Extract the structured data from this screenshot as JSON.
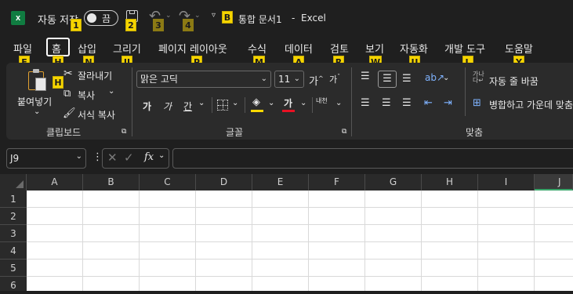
{
  "titlebar": {
    "autosave_label": "자동 저장",
    "autosave_state": "끔",
    "title": "통합 문서1",
    "separator": "-",
    "app_name": "Excel",
    "keytips": {
      "autosave": "1",
      "save": "2",
      "undo": "3",
      "redo": "4",
      "title": "B"
    }
  },
  "tabs": [
    {
      "label": "파일",
      "keytip": "F"
    },
    {
      "label": "홈",
      "keytip": "H"
    },
    {
      "label": "삽입",
      "keytip": "N"
    },
    {
      "label": "그리기",
      "keytip": "JI"
    },
    {
      "label": "페이지 레이아웃",
      "keytip": "P"
    },
    {
      "label": "수식",
      "keytip": "M"
    },
    {
      "label": "데이터",
      "keytip": "A"
    },
    {
      "label": "검토",
      "keytip": "R"
    },
    {
      "label": "보기",
      "keytip": "W"
    },
    {
      "label": "자동화",
      "keytip": "U"
    },
    {
      "label": "개발 도구",
      "keytip": "L"
    },
    {
      "label": "도움말",
      "keytip": "Y"
    }
  ],
  "clipboard": {
    "paste_label": "붙여넣기",
    "cut_label": "잘라내기",
    "copy_label": "복사",
    "format_painter_label": "서식 복사",
    "group_label": "클립보드"
  },
  "font": {
    "name": "맑은 고딕",
    "size": "11",
    "bold": "가",
    "italic": "가",
    "underline": "간",
    "font_color_glyph": "가",
    "phonetic_glyph": "내천",
    "group_label": "글꼴"
  },
  "alignment": {
    "wrap_text_label": "자동 줄 바꿈",
    "merge_label": "병합하고 가운데 맞춤",
    "group_label": "맞춤"
  },
  "formula_bar": {
    "name_box": "J9",
    "fx": "fx",
    "formula": ""
  },
  "grid": {
    "columns": [
      "A",
      "B",
      "C",
      "D",
      "E",
      "F",
      "G",
      "H",
      "I",
      "J"
    ],
    "rows": [
      "1",
      "2",
      "3",
      "4",
      "5",
      "6"
    ],
    "selected_column": "J"
  },
  "colors": {
    "background": "#1f1f1f",
    "ribbon": "#2b2b2b",
    "keytip": "#f5d400",
    "font_color_bar": "#e81123",
    "highlight_bar": "#ffd800",
    "excel_green": "#107c41"
  }
}
